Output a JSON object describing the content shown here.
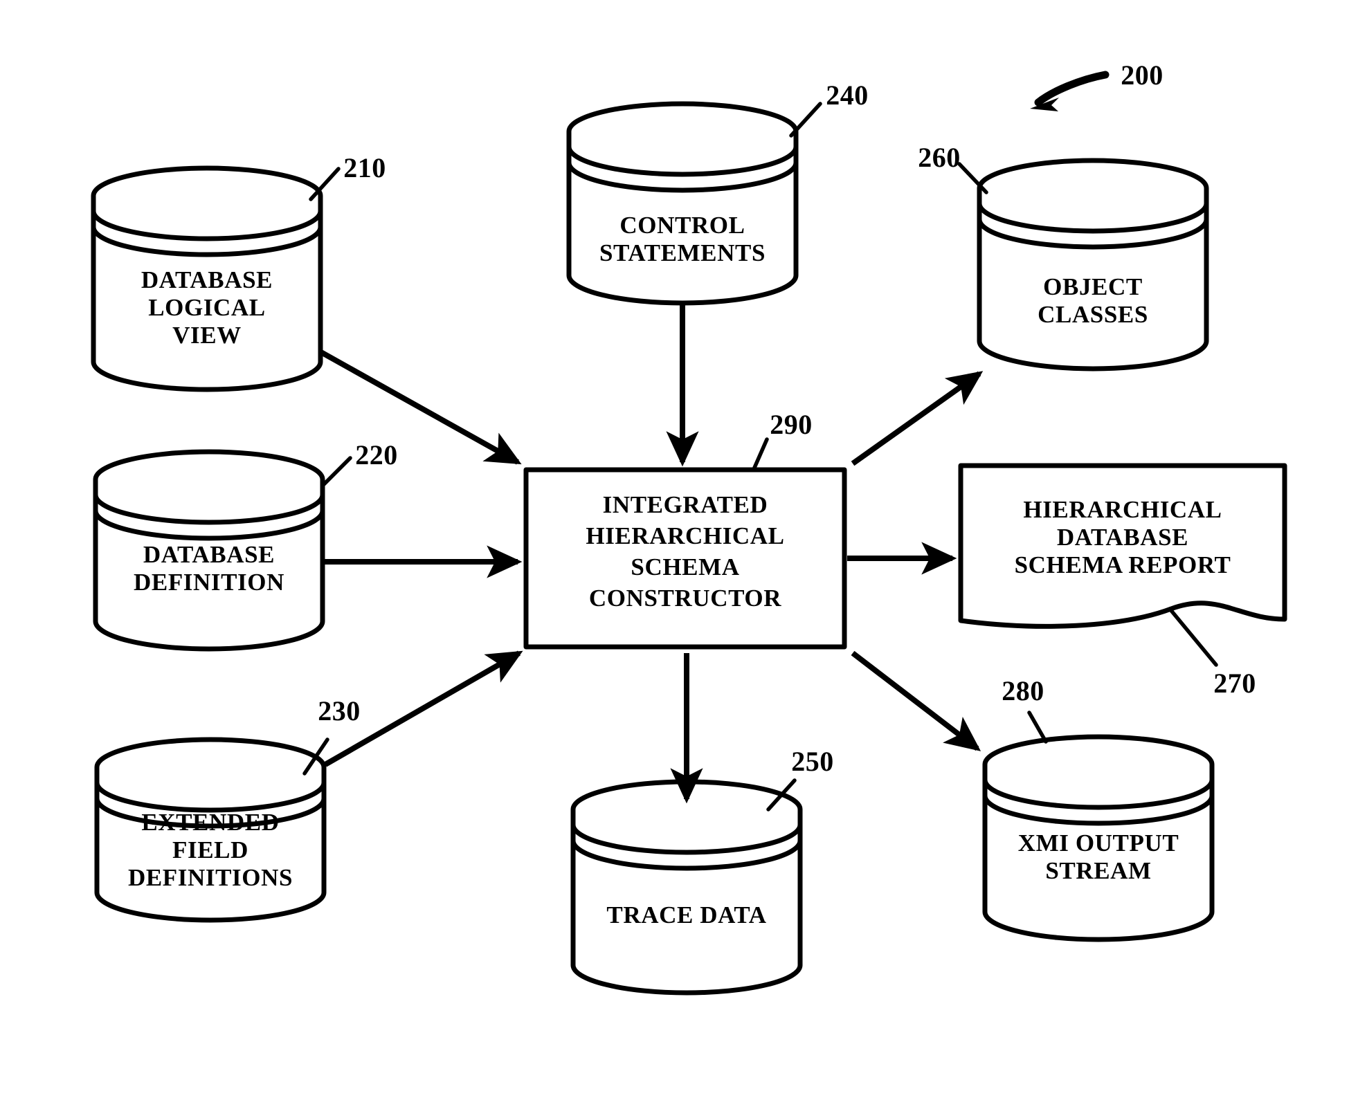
{
  "figure": {
    "figure_ref": "200",
    "background_color": "#ffffff",
    "ink_color": "#000000"
  },
  "nodes": {
    "database_logical_view": {
      "ref": "210",
      "shape": "cylinder",
      "lines": [
        "DATABASE",
        "LOGICAL",
        "VIEW"
      ]
    },
    "database_definition": {
      "ref": "220",
      "shape": "cylinder",
      "lines": [
        "DATABASE",
        "DEFINITION"
      ]
    },
    "extended_field_definitions": {
      "ref": "230",
      "shape": "cylinder",
      "lines": [
        "EXTENDED",
        "FIELD",
        "DEFINITIONS"
      ]
    },
    "control_statements": {
      "ref": "240",
      "shape": "cylinder",
      "lines": [
        "CONTROL",
        "STATEMENTS"
      ]
    },
    "trace_data": {
      "ref": "250",
      "shape": "cylinder",
      "lines": [
        "TRACE DATA"
      ]
    },
    "object_classes": {
      "ref": "260",
      "shape": "cylinder",
      "lines": [
        "OBJECT",
        "CLASSES"
      ]
    },
    "hierarchical_database_schema_report": {
      "ref": "270",
      "shape": "document",
      "lines": [
        "HIERARCHICAL",
        "DATABASE",
        "SCHEMA REPORT"
      ]
    },
    "xmi_output_stream": {
      "ref": "280",
      "shape": "cylinder",
      "lines": [
        "XMI OUTPUT",
        "STREAM"
      ]
    },
    "integrated_hierarchical_schema_constructor": {
      "ref": "290",
      "shape": "rectangle",
      "lines": [
        "INTEGRATED",
        "HIERARCHICAL",
        "SCHEMA",
        "CONSTRUCTOR"
      ]
    }
  },
  "flows": [
    {
      "from": "database_logical_view",
      "to": "integrated_hierarchical_schema_constructor",
      "direction": "in"
    },
    {
      "from": "database_definition",
      "to": "integrated_hierarchical_schema_constructor",
      "direction": "in"
    },
    {
      "from": "extended_field_definitions",
      "to": "integrated_hierarchical_schema_constructor",
      "direction": "in"
    },
    {
      "from": "control_statements",
      "to": "integrated_hierarchical_schema_constructor",
      "direction": "in"
    },
    {
      "from": "integrated_hierarchical_schema_constructor",
      "to": "object_classes",
      "direction": "out"
    },
    {
      "from": "integrated_hierarchical_schema_constructor",
      "to": "hierarchical_database_schema_report",
      "direction": "out"
    },
    {
      "from": "integrated_hierarchical_schema_constructor",
      "to": "xmi_output_stream",
      "direction": "out"
    },
    {
      "from": "integrated_hierarchical_schema_constructor",
      "to": "trace_data",
      "direction": "out"
    }
  ]
}
